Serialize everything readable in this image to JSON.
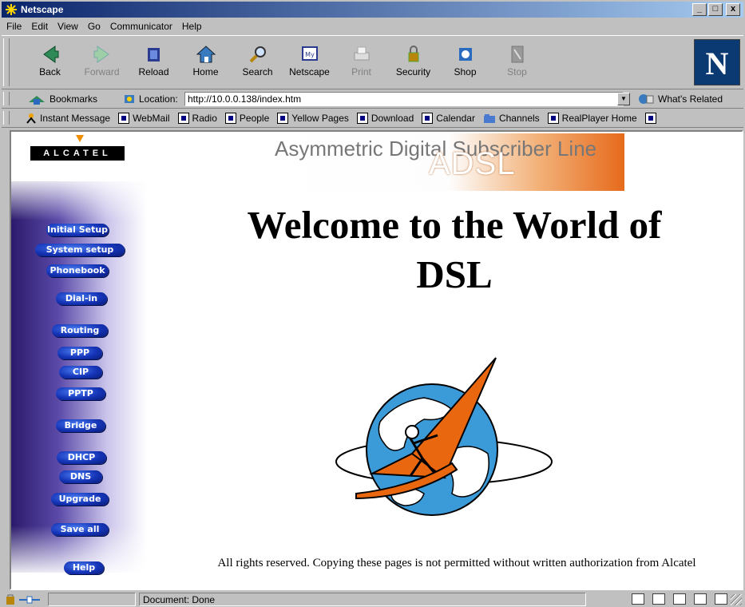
{
  "window": {
    "title": "Netscape",
    "controls": [
      "_",
      "□",
      "x"
    ]
  },
  "menubar": [
    "File",
    "Edit",
    "View",
    "Go",
    "Communicator",
    "Help"
  ],
  "nav_toolbar": [
    {
      "label": "Back",
      "icon": "back-arrow-icon",
      "enabled": true
    },
    {
      "label": "Forward",
      "icon": "forward-arrow-icon",
      "enabled": false
    },
    {
      "label": "Reload",
      "icon": "reload-icon",
      "enabled": true
    },
    {
      "label": "Home",
      "icon": "home-icon",
      "enabled": true
    },
    {
      "label": "Search",
      "icon": "search-icon",
      "enabled": true
    },
    {
      "label": "Netscape",
      "icon": "netscape-my-icon",
      "enabled": true
    },
    {
      "label": "Print",
      "icon": "print-icon",
      "enabled": false
    },
    {
      "label": "Security",
      "icon": "security-lock-icon",
      "enabled": true
    },
    {
      "label": "Shop",
      "icon": "shop-icon",
      "enabled": true
    },
    {
      "label": "Stop",
      "icon": "stop-icon",
      "enabled": false
    }
  ],
  "location": {
    "bookmarks_label": "Bookmarks",
    "location_label": "Location:",
    "url": "http://10.0.0.138/index.htm",
    "related_label": "What's Related"
  },
  "personal_toolbar": [
    {
      "label": "Instant Message",
      "icon": "instant-message-icon"
    },
    {
      "label": "WebMail",
      "icon": "bookmark-icon"
    },
    {
      "label": "Radio",
      "icon": "bookmark-icon"
    },
    {
      "label": "People",
      "icon": "bookmark-icon"
    },
    {
      "label": "Yellow Pages",
      "icon": "bookmark-icon"
    },
    {
      "label": "Download",
      "icon": "bookmark-icon"
    },
    {
      "label": "Calendar",
      "icon": "bookmark-icon"
    },
    {
      "label": "Channels",
      "icon": "channels-folder-icon"
    },
    {
      "label": "RealPlayer Home",
      "icon": "bookmark-icon"
    }
  ],
  "page": {
    "brand": "ALCATEL",
    "banner_subtitle": "Asymmetric Digital Subscriber Line",
    "banner_title": "ADSL",
    "welcome_line1": "Welcome to the World of",
    "welcome_line2": "DSL",
    "footer": "All rights reserved. Copying these pages is not permitted without written authorization from Alcatel",
    "menu": [
      "Initial Setup",
      "System setup",
      "Phonebook",
      "Dial-in",
      "Routing",
      "PPP",
      "CIP",
      "PPTP",
      "Bridge",
      "DHCP",
      "DNS",
      "Upgrade",
      "Save all",
      "Help"
    ]
  },
  "statusbar": {
    "status": "Document: Done"
  },
  "colors": {
    "titlebar": "#0a246a",
    "menu_button": "#1535b8",
    "banner_orange": "#e66a1c",
    "logo_orange": "#e8670f",
    "logo_blue": "#3b9ad8"
  }
}
